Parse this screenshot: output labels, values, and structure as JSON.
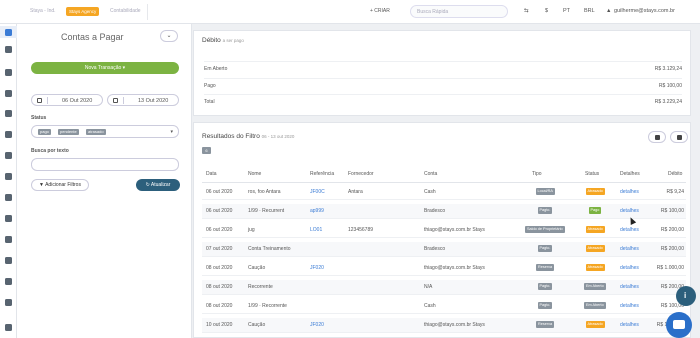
{
  "topbar": {
    "crumb1": "Staya - Ind.",
    "badge": "Stays Agency",
    "crumb2": "Contabilidade",
    "criar": "+ CRIAR",
    "search_placeholder": "Busca Rápida",
    "lang": "PT",
    "currency": "BRL",
    "user": "guilherme@stays.com.br"
  },
  "panel": {
    "title": "Contas a Pagar",
    "nova_transacao": "Nova Transação ▾",
    "date_from": "06 Out 2020",
    "date_to": "13 Out 2020",
    "status_label": "Status",
    "status_chips": [
      "pago",
      "pendente",
      "atrasado"
    ],
    "busca_label": "Busca por texto",
    "busca_value": "",
    "add_filters": "Adicionar Filtros",
    "update": "Atualizar"
  },
  "debit": {
    "title": "Débito",
    "subtitle": "a ser pago",
    "rows": [
      {
        "label": "Em Aberto",
        "value": "R$ 3.129,24"
      },
      {
        "label": "Pago",
        "value": "R$ 100,00"
      },
      {
        "label": "Total",
        "value": "R$ 3.229,24"
      }
    ]
  },
  "results": {
    "title": "Resultados do Filtro",
    "subtitle": "06 - 13 out 2020",
    "tag": "6",
    "headers": [
      "Data",
      "Nome",
      "Referência",
      "Fornecedor",
      "Conta",
      "Tipo",
      "Status",
      "Detalhes",
      "Débito"
    ],
    "rows": [
      {
        "date": "06 out 2020",
        "name": "ros, foo Antara",
        "ref": "JF00C",
        "supplier": "Antara",
        "account": "Cash",
        "type": "Local/RA",
        "status": "Atrasado",
        "details": "detalhes",
        "debit": "R$ 9,24"
      },
      {
        "date": "06 out 2020",
        "name": "1/99 · Recurrent",
        "ref": "ap999",
        "supplier": "",
        "account": "Bradesco",
        "type": "Pagto.",
        "status": "Pago",
        "details": "detalhes",
        "debit": "R$ 100,00"
      },
      {
        "date": "06 out 2020",
        "name": "jug",
        "ref": "LO01",
        "supplier": "123456789",
        "account": "thiago@stays.com.br Stays",
        "type": "Saldo de Proprietário",
        "status": "Atrasado",
        "details": "detalhes",
        "debit": "R$ 200,00"
      },
      {
        "date": "07 out 2020",
        "name": "Conta Treinamento",
        "ref": "",
        "supplier": "",
        "account": "Bradesco",
        "type": "Pagto.",
        "status": "Atrasado",
        "details": "detalhes",
        "debit": "R$ 200,00"
      },
      {
        "date": "08 out 2020",
        "name": "Caução",
        "ref": "JF020",
        "supplier": "",
        "account": "thiago@stays.com.br Stays",
        "type": "Reserva",
        "status": "Atrasado",
        "details": "detalhes",
        "debit": "R$ 1.000,00"
      },
      {
        "date": "08 out 2020",
        "name": "Recorrente",
        "ref": "",
        "supplier": "",
        "account": "N/A",
        "type": "Pagto.",
        "status": "Em Aberto",
        "details": "detalhes",
        "debit": "R$ 200,00"
      },
      {
        "date": "08 out 2020",
        "name": "1/99 · Recorrente",
        "ref": "",
        "supplier": "",
        "account": "Cash",
        "type": "Pagto.",
        "status": "Em Aberto",
        "details": "detalhes",
        "debit": "R$ 100,00"
      },
      {
        "date": "10 out 2020",
        "name": "Caução",
        "ref": "JF020",
        "supplier": "",
        "account": "thiago@stays.com.br Stays",
        "type": "Reserva",
        "status": "Atrasado",
        "details": "detalhes",
        "debit": "R$ 1.000,00"
      }
    ]
  },
  "colors": {
    "primary": "#3a7bd5",
    "green": "#7cb342",
    "orange": "#f5a623",
    "grey_pill": "#8a949e",
    "dark_blue": "#2c5f7c"
  }
}
